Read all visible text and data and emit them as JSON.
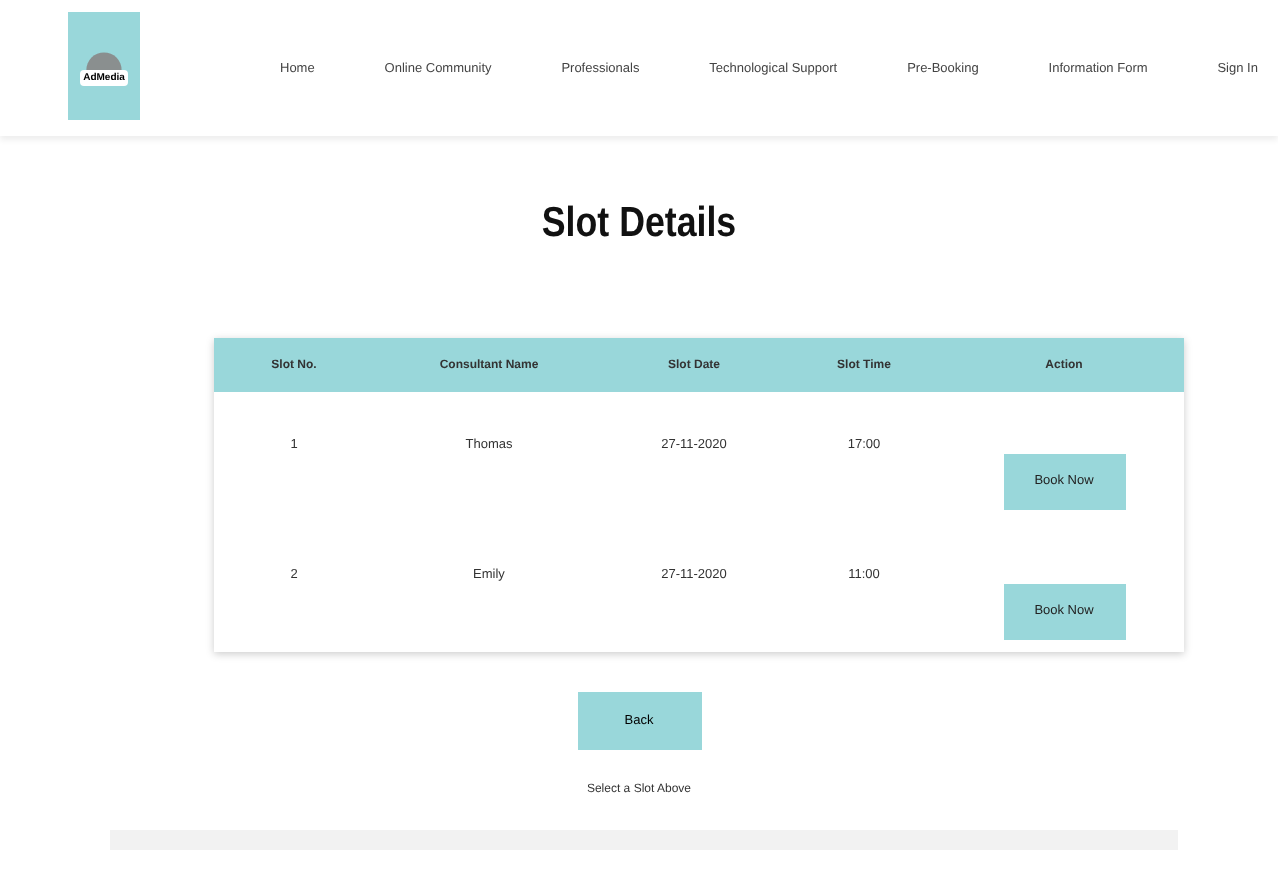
{
  "logo": {
    "text": "AdMedia"
  },
  "nav": [
    "Home",
    "Online Community",
    "Professionals",
    "Technological Support",
    "Pre-Booking",
    "Information Form",
    "Sign In"
  ],
  "title": "Slot Details",
  "table": {
    "columns": [
      "Slot No.",
      "Consultant Name",
      "Slot Date",
      "Slot Time",
      "Action"
    ],
    "rows": [
      {
        "cells": [
          "1",
          "Thomas",
          "27-11-2020",
          "17:00"
        ],
        "action": "Book Now"
      },
      {
        "cells": [
          "2",
          "Emily",
          "27-11-2020",
          "11:00"
        ],
        "action": "Book Now"
      }
    ]
  },
  "back_button": "Back",
  "note": "Select a Slot Above"
}
